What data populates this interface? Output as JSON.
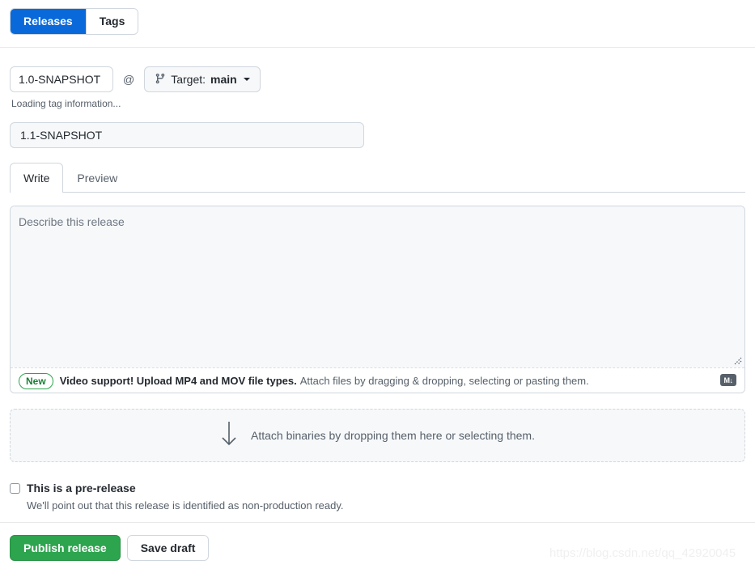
{
  "nav": {
    "tabs": [
      {
        "label": "Releases",
        "active": true
      },
      {
        "label": "Tags",
        "active": false
      }
    ]
  },
  "tag_row": {
    "tag_value": "1.0-SNAPSHOT",
    "tag_placeholder": "Tag version",
    "at_symbol": "@",
    "target_icon": "git-branch-icon",
    "target_label": "Target:",
    "target_value": "main",
    "loading_note": "Loading tag information..."
  },
  "title": {
    "value": "1.1-SNAPSHOT",
    "placeholder": "Release title"
  },
  "editor": {
    "tabs": [
      {
        "label": "Write",
        "selected": true
      },
      {
        "label": "Preview",
        "selected": false
      }
    ],
    "body_placeholder": "Describe this release",
    "body_value": "",
    "footer": {
      "badge": "New",
      "strong_text": "Video support! Upload MP4 and MOV file types.",
      "normal_text": "Attach files by dragging & dropping, selecting or pasting them.",
      "markdown_icon_label": "M↓"
    }
  },
  "dropzone": {
    "icon": "arrow-down-icon",
    "text": "Attach binaries by dropping them here or selecting them."
  },
  "prerelease": {
    "checked": false,
    "label": "This is a pre-release",
    "description": "We'll point out that this release is identified as non-production ready."
  },
  "actions": {
    "publish_label": "Publish release",
    "draft_label": "Save draft"
  },
  "watermark": {
    "text": "https://blog.csdn.net/qq_42920045"
  },
  "colors": {
    "accent_blue": "#0969da",
    "success_green": "#2da44e",
    "badge_green": "#1a7f37",
    "border": "#d0d7de",
    "text": "#24292f",
    "muted": "#57606a"
  }
}
